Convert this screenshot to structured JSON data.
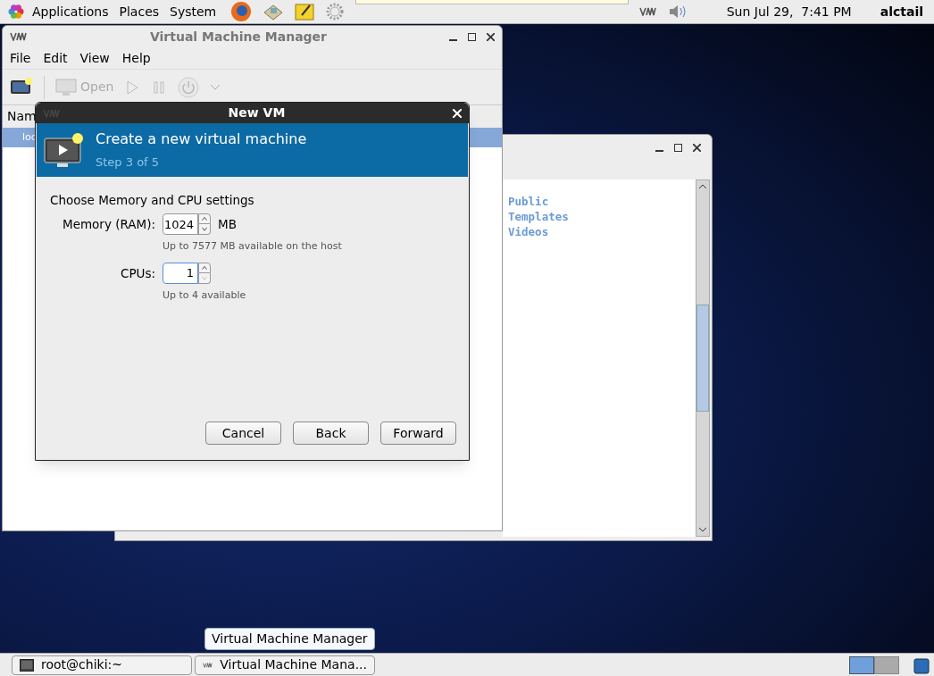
{
  "top_panel": {
    "menus": [
      "Applications",
      "Places",
      "System"
    ],
    "clock": "Sun Jul 29,  7:41 PM",
    "user": "alctail"
  },
  "vmm_window": {
    "title": "Virtual Machine Manager",
    "menus": [
      "File",
      "Edit",
      "View",
      "Help"
    ],
    "open_label": "Open",
    "column_1": "Nam",
    "row": {
      "text": "loc",
      "selected": true
    }
  },
  "file_window": {
    "items": [
      "Public",
      "Templates",
      "Videos"
    ]
  },
  "dialog": {
    "title": "New VM",
    "header_title": "Create a new virtual machine",
    "header_step": "Step 3 of 5",
    "section": "Choose Memory and CPU settings",
    "fields": [
      {
        "label": "Memory (RAM):",
        "value": "1024",
        "unit": "MB",
        "hint": "Up to 7577 MB available on the host",
        "focused": false,
        "down_disabled": false
      },
      {
        "label": "CPUs:",
        "value": "1",
        "hint": "Up to 4 available",
        "focused": true,
        "down_disabled": true
      }
    ],
    "buttons": [
      "Cancel",
      "Back",
      "Forward"
    ]
  },
  "tooltip": "Virtual Machine Manager",
  "taskbar": {
    "tasks": [
      {
        "kind": "terminal",
        "label": "root@chiki:~"
      },
      {
        "kind": "vmm",
        "label": "Virtual Machine Mana..."
      }
    ]
  }
}
